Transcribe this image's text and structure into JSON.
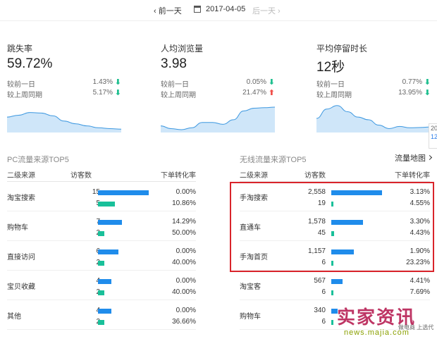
{
  "datebar": {
    "prev": "前一天",
    "date": "2017-04-05",
    "next": "后一天"
  },
  "metrics": [
    {
      "title": "跳失率",
      "value": "59.72%",
      "rows": [
        {
          "label": "较前一日",
          "pct": "1.43%",
          "dir": "down"
        },
        {
          "label": "较上周同期",
          "pct": "5.17%",
          "dir": "down"
        }
      ],
      "trend": [
        0.55,
        0.62,
        0.72,
        0.7,
        0.6,
        0.4,
        0.3,
        0.22,
        0.15,
        0.12,
        0.1
      ]
    },
    {
      "title": "人均浏览量",
      "value": "3.98",
      "rows": [
        {
          "label": "较前一日",
          "pct": "0.05%",
          "dir": "down"
        },
        {
          "label": "较上周同期",
          "pct": "21.47%",
          "dir": "up"
        }
      ],
      "trend": [
        0.22,
        0.12,
        0.08,
        0.15,
        0.35,
        0.35,
        0.28,
        0.45,
        0.78,
        0.88,
        0.9,
        0.92
      ]
    },
    {
      "title": "平均停留时长",
      "value": "12秒",
      "rows": [
        {
          "label": "较前一日",
          "pct": "0.77%",
          "dir": "down"
        },
        {
          "label": "较上周同期",
          "pct": "13.95%",
          "dir": "down"
        }
      ],
      "trend": [
        0.5,
        0.85,
        0.98,
        0.75,
        0.55,
        0.45,
        0.25,
        0.12,
        0.2,
        0.15,
        0.16,
        0.18
      ]
    }
  ],
  "scroll_tooltip": {
    "line1": "20",
    "line2": "12"
  },
  "pc_table": {
    "title": "PC流量来源TOP5",
    "headers": {
      "source": "二级来源",
      "visitors": "访客数",
      "conversion": "下单转化率"
    },
    "rows": [
      {
        "name": "淘宝搜索",
        "v1": "15",
        "v2": "5",
        "p1": "0.00%",
        "p2": "10.86%",
        "b1": 1.0,
        "b2": 0.33
      },
      {
        "name": "购物车",
        "v1": "7",
        "v2": "2",
        "p1": "14.29%",
        "p2": "50.00%",
        "b1": 0.47,
        "b2": 0.13
      },
      {
        "name": "直接访问",
        "v1": "6",
        "v2": "2",
        "p1": "0.00%",
        "p2": "40.00%",
        "b1": 0.4,
        "b2": 0.13
      },
      {
        "name": "宝贝收藏",
        "v1": "4",
        "v2": "2",
        "p1": "0.00%",
        "p2": "40.00%",
        "b1": 0.27,
        "b2": 0.13
      },
      {
        "name": "其他",
        "v1": "4",
        "v2": "2",
        "p1": "0.00%",
        "p2": "36.66%",
        "b1": 0.27,
        "b2": 0.13
      }
    ]
  },
  "mobile_table": {
    "title": "无线流量来源TOP5",
    "map_link": "流量地图",
    "headers": {
      "source": "二级来源",
      "visitors": "访客数",
      "conversion": "下单转化率"
    },
    "rows": [
      {
        "name": "手淘搜索",
        "v1": "2,558",
        "v2": "19",
        "p1": "3.13%",
        "p2": "4.55%",
        "b1": 1.0,
        "b2": 0.04
      },
      {
        "name": "直通车",
        "v1": "1,578",
        "v2": "45",
        "p1": "3.30%",
        "p2": "4.43%",
        "b1": 0.62,
        "b2": 0.05
      },
      {
        "name": "手淘首页",
        "v1": "1,157",
        "v2": "6",
        "p1": "1.90%",
        "p2": "23.23%",
        "b1": 0.45,
        "b2": 0.03
      },
      {
        "name": "淘宝客",
        "v1": "567",
        "v2": "6",
        "p1": "4.41%",
        "p2": "7.69%",
        "b1": 0.22,
        "b2": 0.03
      },
      {
        "name": "购物车",
        "v1": "340",
        "v2": "6",
        "p1": "",
        "p2": "",
        "b1": 0.13,
        "b2": 0.03
      }
    ]
  },
  "watermark": {
    "big": "实家资讯",
    "url": "news.majia.com",
    "sub": "做电商 上选代"
  },
  "colors": {
    "bar_visitors": "#1f8ceb",
    "bar_buyers": "#19c09a",
    "down": "#1fbf8f",
    "up": "#f0504a",
    "highlight": "#d9242b",
    "area": "#cfe6f9",
    "line": "#3d98e0"
  }
}
